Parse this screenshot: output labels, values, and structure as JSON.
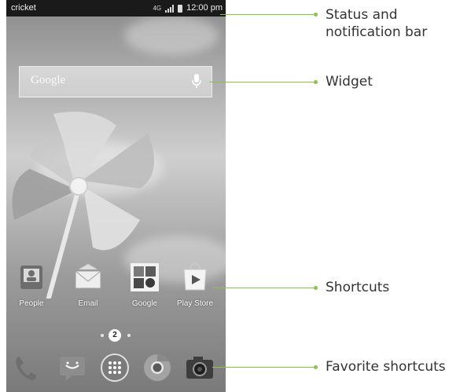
{
  "status_bar": {
    "carrier": "cricket",
    "network": "4G",
    "time": "12:00 pm"
  },
  "widget": {
    "label": "Google"
  },
  "shortcuts": [
    {
      "label": "People",
      "icon": "people-icon"
    },
    {
      "label": "Email",
      "icon": "email-icon"
    },
    {
      "label": "Google",
      "icon": "google-folder-icon"
    },
    {
      "label": "Play Store",
      "icon": "play-store-icon"
    }
  ],
  "pager": {
    "current_page": "2"
  },
  "dock": [
    {
      "icon": "phone-icon"
    },
    {
      "icon": "messaging-icon"
    },
    {
      "icon": "app-drawer-icon"
    },
    {
      "icon": "chrome-icon"
    },
    {
      "icon": "camera-icon"
    }
  ],
  "annotations": [
    "Status and\nnotification bar",
    "Widget",
    "Shortcuts",
    "Favorite shortcuts"
  ],
  "colors": {
    "callout": "#8bc34a",
    "status_bar": "#1a1a1a"
  }
}
